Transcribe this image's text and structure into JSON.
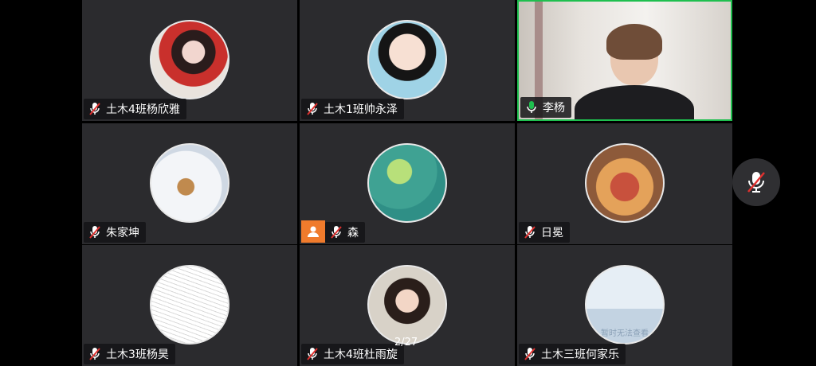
{
  "participants": [
    {
      "name": "土木4班杨欣雅",
      "mic": "muted"
    },
    {
      "name": "土木1班帅永泽",
      "mic": "muted"
    },
    {
      "name": "李杨",
      "mic": "active"
    },
    {
      "name": "朱家坤",
      "mic": "muted"
    },
    {
      "name": "森",
      "mic": "muted",
      "host_icon": "person-icon"
    },
    {
      "name": "日冕",
      "mic": "muted"
    },
    {
      "name": "土木3班杨昊",
      "mic": "muted"
    },
    {
      "name": "土木4班杜雨旋",
      "mic": "muted"
    },
    {
      "name": "土木三班何家乐",
      "mic": "muted",
      "avatar_text": "暂时无法查看"
    }
  ],
  "page_indicator": "2/27",
  "floating_mic": {
    "icon": "mic-muted-icon"
  },
  "colors": {
    "active_border": "#1fbf4f",
    "mic_muted": "#e0312f",
    "mic_active": "#1fbf4f",
    "host_badge": "#f07b2c"
  }
}
